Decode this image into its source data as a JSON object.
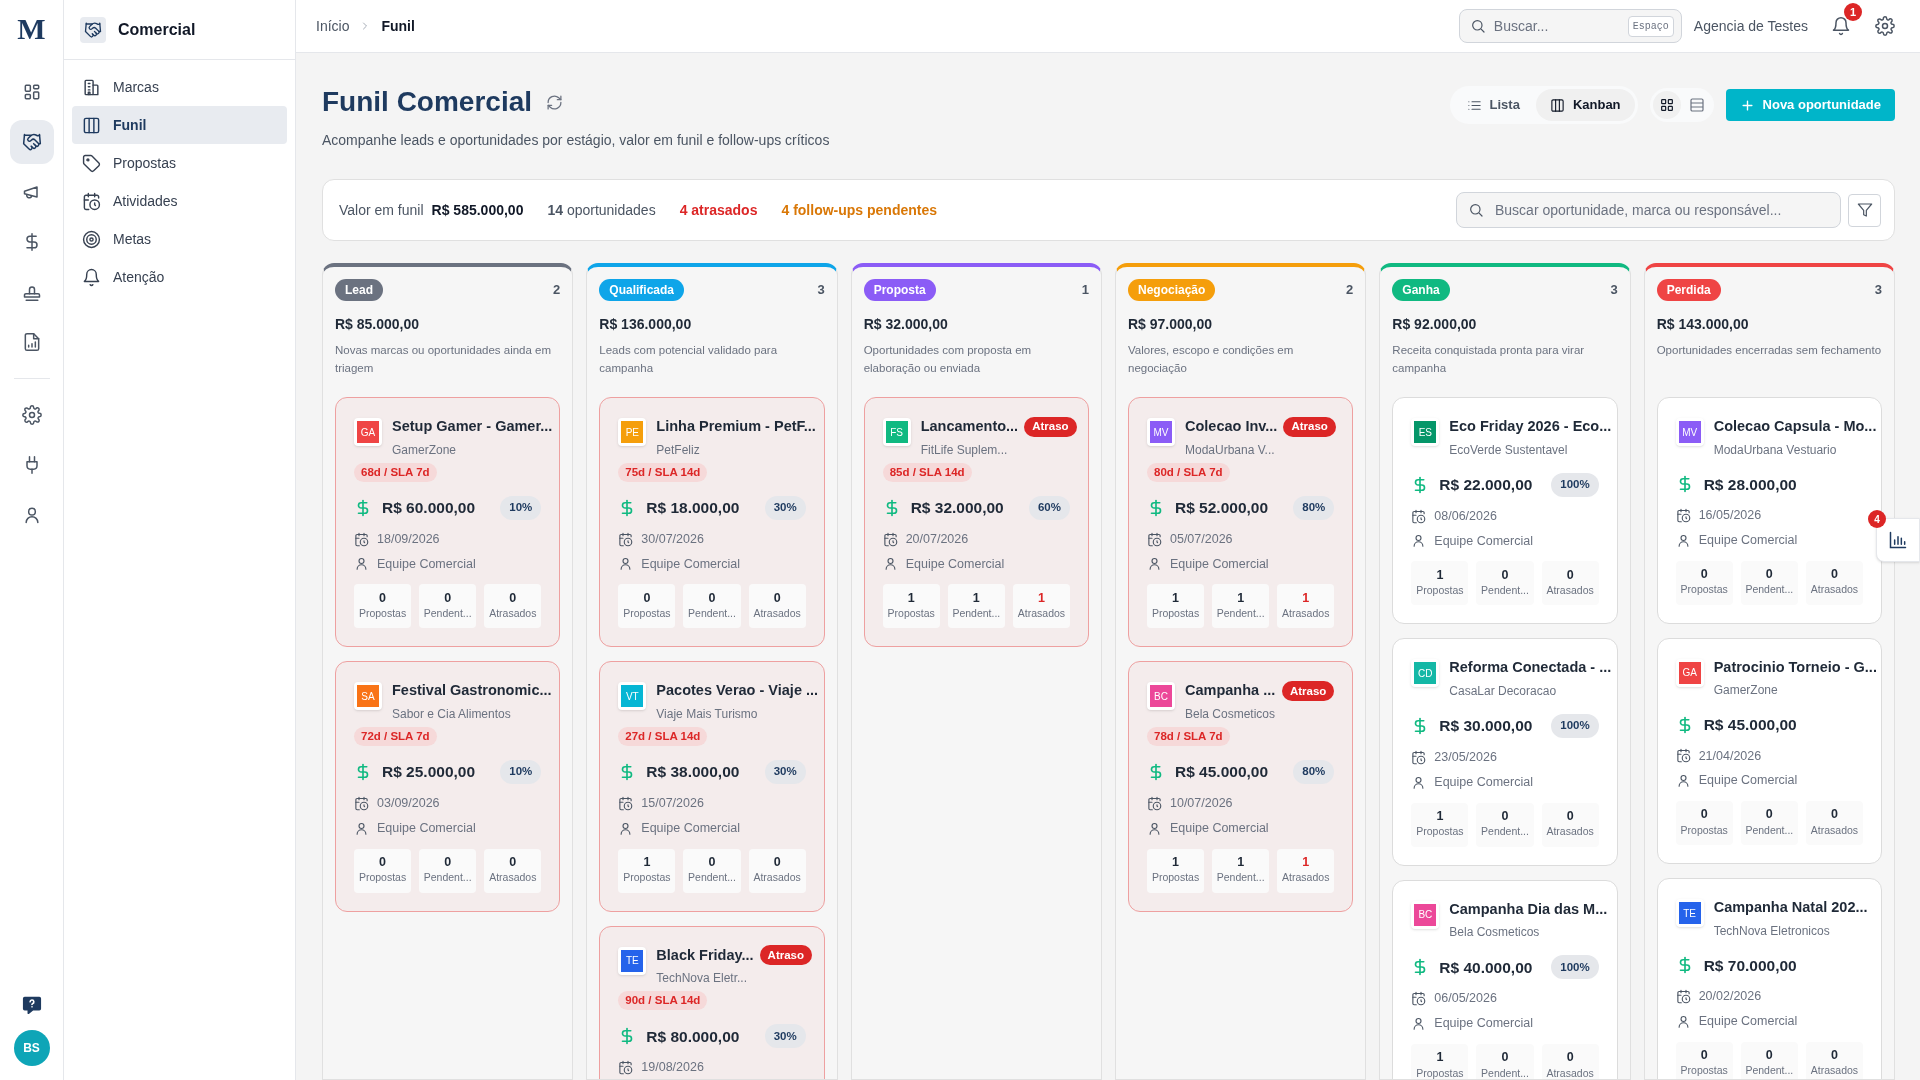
{
  "logo": {
    "text": "M"
  },
  "rail": [
    {
      "selected": false
    },
    {
      "selected": true
    },
    {
      "selected": false
    },
    {
      "selected": false
    },
    {
      "selected": false
    },
    {
      "selected": false
    }
  ],
  "rail_bottom": [
    {
      "selected": false
    },
    {
      "selected": false
    },
    {
      "selected": false
    }
  ],
  "avatar": {
    "initials": "BS"
  },
  "sidebar": {
    "title": "Comercial",
    "items": [
      {
        "label": "Marcas",
        "selected": false
      },
      {
        "label": "Funil",
        "selected": true
      },
      {
        "label": "Propostas",
        "selected": false
      },
      {
        "label": "Atividades",
        "selected": false
      },
      {
        "label": "Metas",
        "selected": false
      },
      {
        "label": "Atenção",
        "selected": false
      }
    ]
  },
  "breadcrumb": [
    "Início",
    "Funil"
  ],
  "topbar": {
    "search_placeholder": "Buscar...",
    "shortcut": "Espaço",
    "account": "Agencia de Testes",
    "notifications": "1"
  },
  "page": {
    "title": "Funil Comercial",
    "subtitle": "Acompanhe leads e oportunidades por estágio, valor em funil e follow-ups críticos"
  },
  "view_tabs": [
    {
      "label": "Lista",
      "selected": false
    },
    {
      "label": "Kanban",
      "selected": true
    }
  ],
  "density": [
    {
      "selected": true
    },
    {
      "selected": false
    }
  ],
  "new_button": "Nova oportunidade",
  "summary": {
    "value_label": "Valor em funil",
    "value": "R$ 585.000,00",
    "count": "**14** oportunidades",
    "late": "4 atrasados",
    "followups": "4 follow-ups pendentes",
    "search_placeholder": "Buscar oportunidade, marca ou responsável..."
  },
  "stages": [
    {
      "name": "Lead",
      "color": "#6b7280",
      "count": "2",
      "total": "R$ 85.000,00",
      "description": "Novas marcas ou oportunidades ainda em triagem",
      "cards": [
        {
          "initials": "GA",
          "color": "#ef4444",
          "title": "Setup Gamer - Gamer...",
          "company": "GamerZone",
          "overdue": true,
          "late_badge": false,
          "sla": "68d / SLA 7d",
          "value": "R$ 60.000,00",
          "probability": "10%",
          "date": "18/09/2026",
          "owner": "Equipe Comercial",
          "stats": [
            {
              "value": "0",
              "label": "Propostas",
              "alert": false
            },
            {
              "value": "0",
              "label": "Pendent...",
              "alert": false
            },
            {
              "value": "0",
              "label": "Atrasados",
              "alert": false
            }
          ]
        },
        {
          "initials": "SA",
          "color": "#f97316",
          "title": "Festival Gastronomic...",
          "company": "Sabor e Cia Alimentos",
          "overdue": true,
          "late_badge": false,
          "sla": "72d / SLA 7d",
          "value": "R$ 25.000,00",
          "probability": "10%",
          "date": "03/09/2026",
          "owner": "Equipe Comercial",
          "stats": [
            {
              "value": "0",
              "label": "Propostas",
              "alert": false
            },
            {
              "value": "0",
              "label": "Pendent...",
              "alert": false
            },
            {
              "value": "0",
              "label": "Atrasados",
              "alert": false
            }
          ]
        }
      ]
    },
    {
      "name": "Qualificada",
      "color": "#0ea5e9",
      "count": "3",
      "total": "R$ 136.000,00",
      "description": "Leads com potencial validado para campanha",
      "cards": [
        {
          "initials": "PE",
          "color": "#f59e0b",
          "title": "Linha Premium - PetF...",
          "company": "PetFeliz",
          "overdue": true,
          "late_badge": false,
          "sla": "75d / SLA 14d",
          "value": "R$ 18.000,00",
          "probability": "30%",
          "date": "30/07/2026",
          "owner": "Equipe Comercial",
          "stats": [
            {
              "value": "0",
              "label": "Propostas",
              "alert": false
            },
            {
              "value": "0",
              "label": "Pendent...",
              "alert": false
            },
            {
              "value": "0",
              "label": "Atrasados",
              "alert": false
            }
          ]
        },
        {
          "initials": "VT",
          "color": "#06b6d4",
          "title": "Pacotes Verao - Viaje ...",
          "company": "Viaje Mais Turismo",
          "overdue": true,
          "late_badge": false,
          "sla": "27d / SLA 14d",
          "value": "R$ 38.000,00",
          "probability": "30%",
          "date": "15/07/2026",
          "owner": "Equipe Comercial",
          "stats": [
            {
              "value": "1",
              "label": "Propostas",
              "alert": false
            },
            {
              "value": "0",
              "label": "Pendent...",
              "alert": false
            },
            {
              "value": "0",
              "label": "Atrasados",
              "alert": false
            }
          ]
        },
        {
          "initials": "TE",
          "color": "#2563eb",
          "title": "Black Friday...",
          "company": "TechNova Eletr...",
          "overdue": true,
          "late_badge": true,
          "late_text": "Atraso",
          "sla": "90d / SLA 14d",
          "value": "R$ 80.000,00",
          "probability": "30%",
          "date": "19/08/2026"
        }
      ]
    },
    {
      "name": "Proposta",
      "color": "#8b5cf6",
      "count": "1",
      "total": "R$ 32.000,00",
      "description": "Oportunidades com proposta em elaboração ou enviada",
      "cards": [
        {
          "initials": "FS",
          "color": "#10b981",
          "title": "Lancamento...",
          "company": "FitLife Suplem...",
          "overdue": true,
          "late_badge": true,
          "late_text": "Atraso",
          "sla": "85d / SLA 14d",
          "value": "R$ 32.000,00",
          "probability": "60%",
          "date": "20/07/2026",
          "owner": "Equipe Comercial",
          "stats": [
            {
              "value": "1",
              "label": "Propostas",
              "alert": false
            },
            {
              "value": "1",
              "label": "Pendent...",
              "alert": false
            },
            {
              "value": "1",
              "label": "Atrasados",
              "alert": true
            }
          ]
        }
      ]
    },
    {
      "name": "Negociação",
      "color": "#f59e0b",
      "count": "2",
      "total": "R$ 97.000,00",
      "description": "Valores, escopo e condições em negociação",
      "cards": [
        {
          "initials": "MV",
          "color": "#8b5cf6",
          "title": "Colecao Inv...",
          "company": "ModaUrbana V...",
          "overdue": true,
          "late_badge": true,
          "late_text": "Atraso",
          "sla": "80d / SLA 7d",
          "value": "R$ 52.000,00",
          "probability": "80%",
          "date": "05/07/2026",
          "owner": "Equipe Comercial",
          "stats": [
            {
              "value": "1",
              "label": "Propostas",
              "alert": false
            },
            {
              "value": "1",
              "label": "Pendent...",
              "alert": false
            },
            {
              "value": "1",
              "label": "Atrasados",
              "alert": true
            }
          ]
        },
        {
          "initials": "BC",
          "color": "#ec4899",
          "title": "Campanha ...",
          "company": "Bela Cosmeticos",
          "overdue": true,
          "late_badge": true,
          "late_text": "Atraso",
          "sla": "78d / SLA 7d",
          "value": "R$ 45.000,00",
          "probability": "80%",
          "date": "10/07/2026",
          "owner": "Equipe Comercial",
          "stats": [
            {
              "value": "1",
              "label": "Propostas",
              "alert": false
            },
            {
              "value": "1",
              "label": "Pendent...",
              "alert": false
            },
            {
              "value": "1",
              "label": "Atrasados",
              "alert": true
            }
          ]
        }
      ]
    },
    {
      "name": "Ganha",
      "color": "#10b981",
      "count": "3",
      "total": "R$ 92.000,00",
      "description": "Receita conquistada pronta para virar campanha",
      "cards": [
        {
          "initials": "ES",
          "color": "#059669",
          "title": "Eco Friday 2026 - Eco...",
          "company": "EcoVerde Sustentavel",
          "overdue": false,
          "late_badge": false,
          "value": "R$ 22.000,00",
          "probability": "100%",
          "date": "08/06/2026",
          "owner": "Equipe Comercial",
          "stats": [
            {
              "value": "1",
              "label": "Propostas",
              "alert": false
            },
            {
              "value": "0",
              "label": "Pendent...",
              "alert": false
            },
            {
              "value": "0",
              "label": "Atrasados",
              "alert": false
            }
          ]
        },
        {
          "initials": "CD",
          "color": "#14b8a6",
          "title": "Reforma Conectada - ...",
          "company": "CasaLar Decoracao",
          "overdue": false,
          "late_badge": false,
          "value": "R$ 30.000,00",
          "probability": "100%",
          "date": "23/05/2026",
          "owner": "Equipe Comercial",
          "stats": [
            {
              "value": "1",
              "label": "Propostas",
              "alert": false
            },
            {
              "value": "0",
              "label": "Pendent...",
              "alert": false
            },
            {
              "value": "0",
              "label": "Atrasados",
              "alert": false
            }
          ]
        },
        {
          "initials": "BC",
          "color": "#ec4899",
          "title": "Campanha Dia das M...",
          "company": "Bela Cosmeticos",
          "overdue": false,
          "late_badge": false,
          "value": "R$ 40.000,00",
          "probability": "100%",
          "date": "06/05/2026",
          "owner": "Equipe Comercial",
          "stats": [
            {
              "value": "1",
              "label": "Propostas",
              "alert": false
            },
            {
              "value": "0",
              "label": "Pendent...",
              "alert": false
            },
            {
              "value": "0",
              "label": "Atrasados",
              "alert": false
            }
          ]
        }
      ]
    },
    {
      "name": "Perdida",
      "color": "#ef4444",
      "count": "3",
      "total": "R$ 143.000,00",
      "description": "Oportunidades encerradas sem fechamento",
      "cards": [
        {
          "initials": "MV",
          "color": "#8b5cf6",
          "title": "Colecao Capsula - Mo...",
          "company": "ModaUrbana Vestuario",
          "overdue": false,
          "late_badge": false,
          "value": "R$ 28.000,00",
          "date": "16/05/2026",
          "owner": "Equipe Comercial",
          "stats": [
            {
              "value": "0",
              "label": "Propostas",
              "alert": false
            },
            {
              "value": "0",
              "label": "Pendent...",
              "alert": false
            },
            {
              "value": "0",
              "label": "Atrasados",
              "alert": false
            }
          ]
        },
        {
          "initials": "GA",
          "color": "#ef4444",
          "title": "Patrocinio Torneio - G...",
          "company": "GamerZone",
          "overdue": false,
          "late_badge": false,
          "value": "R$ 45.000,00",
          "date": "21/04/2026",
          "owner": "Equipe Comercial",
          "stats": [
            {
              "value": "0",
              "label": "Propostas",
              "alert": false
            },
            {
              "value": "0",
              "label": "Pendent...",
              "alert": false
            },
            {
              "value": "0",
              "label": "Atrasados",
              "alert": false
            }
          ]
        },
        {
          "initials": "TE",
          "color": "#2563eb",
          "title": "Campanha Natal 202...",
          "company": "TechNova Eletronicos",
          "overdue": false,
          "late_badge": false,
          "value": "R$ 70.000,00",
          "date": "20/02/2026",
          "owner": "Equipe Comercial",
          "stats": [
            {
              "value": "0",
              "label": "Propostas",
              "alert": false
            },
            {
              "value": "0",
              "label": "Pendent...",
              "alert": false
            },
            {
              "value": "0",
              "label": "Atrasados",
              "alert": false
            }
          ]
        }
      ]
    }
  ],
  "insights_tab": {
    "badge": "4"
  }
}
